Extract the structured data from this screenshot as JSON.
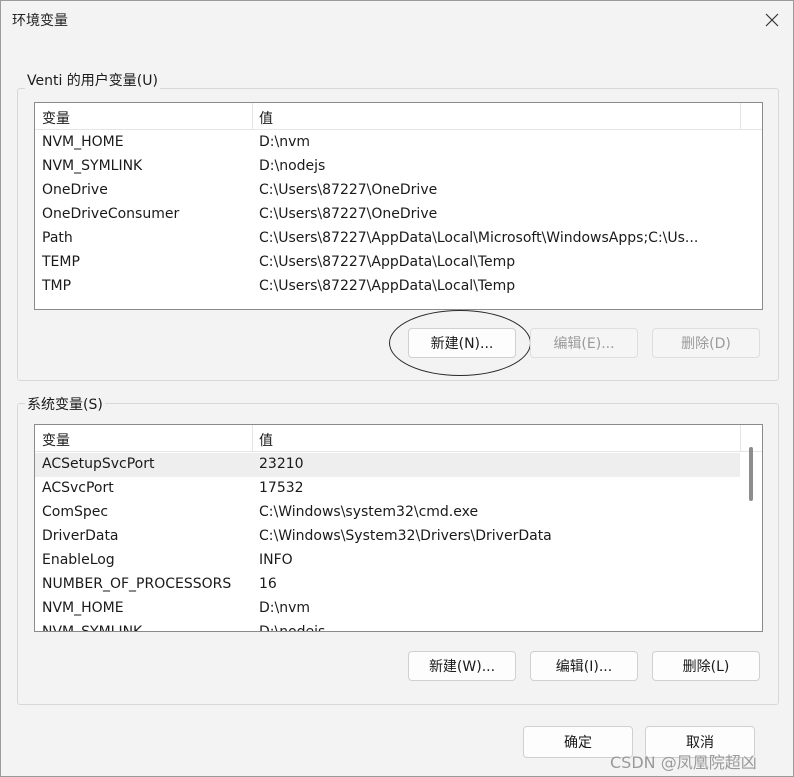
{
  "window": {
    "title": "环境变量"
  },
  "user_vars": {
    "group_label": "Venti 的用户变量(U)",
    "col_name": "变量",
    "col_value": "值",
    "rows": [
      {
        "name": "NVM_HOME",
        "value": "D:\\nvm"
      },
      {
        "name": "NVM_SYMLINK",
        "value": "D:\\nodejs"
      },
      {
        "name": "OneDrive",
        "value": "C:\\Users\\87227\\OneDrive"
      },
      {
        "name": "OneDriveConsumer",
        "value": "C:\\Users\\87227\\OneDrive"
      },
      {
        "name": "Path",
        "value": "C:\\Users\\87227\\AppData\\Local\\Microsoft\\WindowsApps;C:\\Us..."
      },
      {
        "name": "TEMP",
        "value": "C:\\Users\\87227\\AppData\\Local\\Temp"
      },
      {
        "name": "TMP",
        "value": "C:\\Users\\87227\\AppData\\Local\\Temp"
      }
    ],
    "buttons": {
      "new": "新建(N)...",
      "edit": "编辑(E)...",
      "delete": "删除(D)"
    }
  },
  "system_vars": {
    "group_label": "系统变量(S)",
    "col_name": "变量",
    "col_value": "值",
    "rows": [
      {
        "name": "ACSetupSvcPort",
        "value": "23210"
      },
      {
        "name": "ACSvcPort",
        "value": "17532"
      },
      {
        "name": "ComSpec",
        "value": "C:\\Windows\\system32\\cmd.exe"
      },
      {
        "name": "DriverData",
        "value": "C:\\Windows\\System32\\Drivers\\DriverData"
      },
      {
        "name": "EnableLog",
        "value": "INFO"
      },
      {
        "name": "NUMBER_OF_PROCESSORS",
        "value": "16"
      },
      {
        "name": "NVM_HOME",
        "value": "D:\\nvm"
      },
      {
        "name": "NVM_SYMLINK",
        "value": "D:\\nodejs"
      }
    ],
    "buttons": {
      "new": "新建(W)...",
      "edit": "编辑(I)...",
      "delete": "删除(L)"
    }
  },
  "footer": {
    "ok": "确定",
    "cancel": "取消"
  },
  "watermark": "CSDN @凤凰院超凶"
}
